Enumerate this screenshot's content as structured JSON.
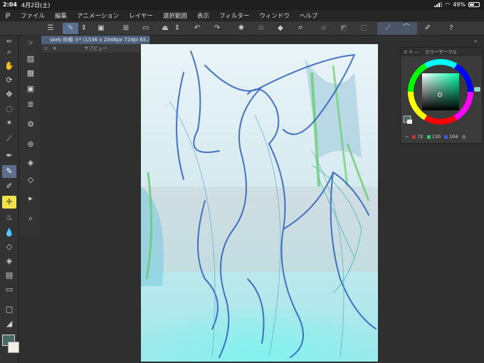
{
  "status": {
    "time": "2:04",
    "date": "4月2日(土)",
    "battery": "49%"
  },
  "menu": [
    "ファイル",
    "編集",
    "アニメーション",
    "レイヤー",
    "選択範囲",
    "表示",
    "フィルター",
    "ウィンドウ",
    "ヘルプ"
  ],
  "document": {
    "tab_title": "skeb 依頼 ⑦* (1536 x 2048px 72dpi 65.3%)",
    "subview_label": "サブビュー"
  },
  "color_panel": {
    "title": "カラーサークル",
    "r": "72",
    "g": "130",
    "b": "104",
    "current_color": "#486a64"
  },
  "colors": {
    "accent": "#5a6f8e",
    "highlight_tool": "#f2e24a"
  },
  "icons": {
    "toolstrip1": [
      "pen-icon",
      "zoom-icon",
      "hand-icon",
      "rotate-icon",
      "move-icon",
      "lasso-icon",
      "magic-wand-icon",
      "eyedropper-icon",
      "pen-tool-icon",
      "pencil-icon",
      "brush-icon",
      "airbrush-icon",
      "decoration-icon",
      "eraser-icon",
      "fill-icon",
      "gradient-icon",
      "figure-icon",
      "frame-icon",
      "text-icon"
    ],
    "toolstrip2": [
      "hand-icon",
      "navigator-icon",
      "layer-icon",
      "sub-view-icon",
      "material-icon",
      "history-icon",
      "auto-action-icon",
      "layer-property-icon",
      "item-bank-icon",
      "timeline-icon",
      "search-icon"
    ]
  }
}
